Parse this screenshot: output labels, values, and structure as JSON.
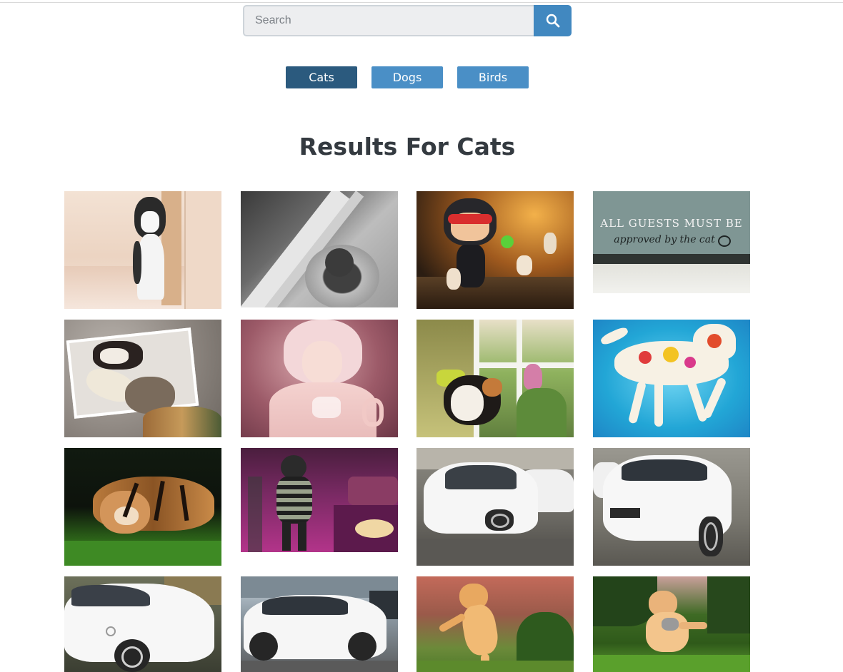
{
  "search": {
    "placeholder": "Search",
    "value": "",
    "button_icon": "search-icon"
  },
  "filters": [
    {
      "label": "Cats",
      "active": true
    },
    {
      "label": "Dogs",
      "active": false
    },
    {
      "label": "Birds",
      "active": false
    }
  ],
  "results": {
    "heading": "Results For Cats"
  },
  "gallery": {
    "row1": {
      "img1_alt": "black and white cat peeking from behind a door",
      "img2_alt": "grey cat in a basket by a window",
      "img3_alt": "cat costume character figure with cat figurines",
      "img4_text_line1": "ALL GUESTS MUST BE",
      "img4_text_line2": "approved by the cat"
    },
    "row2": {
      "img1_alt": "scrapbook collage with dog and cat",
      "img2_alt": "rendered pink-haired character",
      "img3_alt": "calico cat by a window with tulips",
      "img4_alt": "painted floral cat on blue background"
    },
    "row3": {
      "img1_alt": "tiger lying in the grass",
      "img2_alt": "character in striped sweater in a pink room",
      "img3_alt": "white hatchback car front",
      "img4_alt": "white hatchback car rear"
    },
    "row4": {
      "img1_alt": "white car side view",
      "img2_alt": "white car parked on the street",
      "img3_alt": "orange cat leaping on grass",
      "img4_alt": "orange cat playing on grass"
    }
  },
  "colors": {
    "accent": "#4188c0",
    "active_filter": "#2b5a7e",
    "filter": "#4a8fc6",
    "heading": "#343a40"
  }
}
